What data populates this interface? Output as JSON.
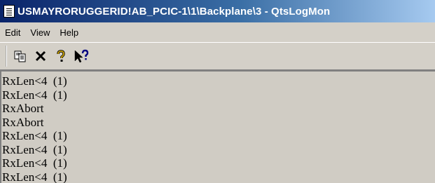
{
  "window": {
    "title": "USMAYRORUGGERID!AB_PCIC-1\\1\\Backplane\\3 - QtsLogMon",
    "app_icon": "document-list-icon"
  },
  "menu": {
    "items": [
      "Edit",
      "View",
      "Help"
    ]
  },
  "toolbar": {
    "buttons": [
      {
        "icon": "copy-icon"
      },
      {
        "icon": "delete-icon"
      },
      {
        "icon": "help-icon"
      },
      {
        "icon": "context-help-icon"
      }
    ]
  },
  "log": {
    "lines": [
      "RxLen<4  (1)",
      "RxLen<4  (1)",
      "RxAbort",
      "RxAbort",
      "RxLen<4  (1)",
      "RxLen<4  (1)",
      "RxLen<4  (1)",
      "RxLen<4  (1)"
    ]
  },
  "colors": {
    "titlebar_start": "#0a246a",
    "titlebar_end": "#a6caf0",
    "chrome": "#d4d0c8",
    "help_icon": "#c8a000",
    "context_help_icon": "#000080"
  }
}
